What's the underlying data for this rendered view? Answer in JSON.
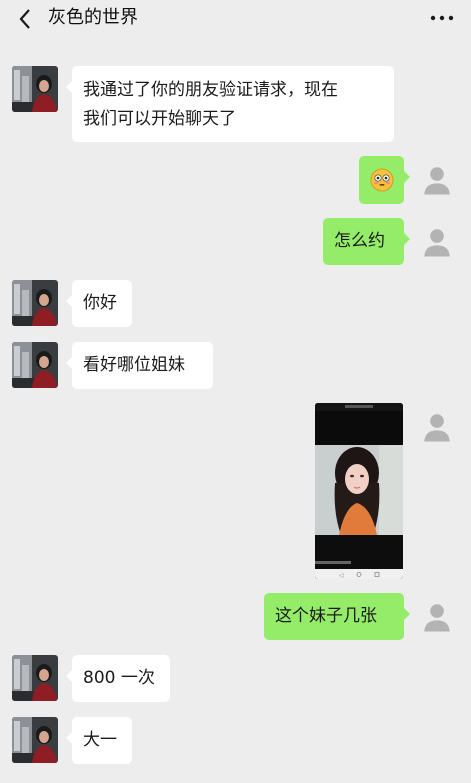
{
  "header": {
    "title": "灰色的世界",
    "back_icon": "chevron-left-icon",
    "more_icon": "more-dots-icon"
  },
  "messages": [
    {
      "side": "left",
      "type": "text",
      "text": "我通过了你的朋友验证请求，现在\n我们可以开始聊天了"
    },
    {
      "side": "right",
      "type": "emoji",
      "emoji": "😳"
    },
    {
      "side": "right",
      "type": "text",
      "text": "怎么约"
    },
    {
      "side": "left",
      "type": "text",
      "text": "你好"
    },
    {
      "side": "left",
      "type": "text",
      "text": "看好哪位姐妹"
    },
    {
      "side": "right",
      "type": "image",
      "caption": "phone-screenshot-photo"
    },
    {
      "side": "right",
      "type": "text",
      "text": "这个妹子几张"
    },
    {
      "side": "left",
      "type": "text",
      "text": "800 一次"
    },
    {
      "side": "left",
      "type": "text",
      "text": "大一"
    }
  ],
  "colors": {
    "background": "#ededed",
    "bubble_self": "#95ec69",
    "bubble_other": "#ffffff"
  }
}
